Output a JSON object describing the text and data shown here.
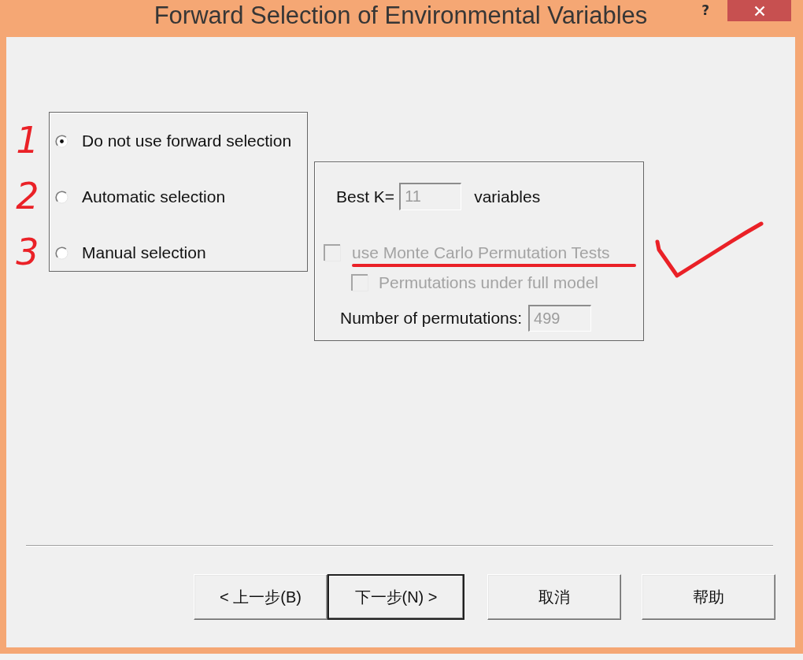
{
  "window": {
    "title": "Forward Selection of Environmental Variables",
    "help": "?"
  },
  "selection_mode": {
    "options": [
      {
        "label": "Do not use forward selection",
        "selected": true,
        "annotation": "1"
      },
      {
        "label": "Automatic selection",
        "selected": false,
        "annotation": "2"
      },
      {
        "label": "Manual selection",
        "selected": false,
        "annotation": "3"
      }
    ]
  },
  "settings": {
    "best_k": {
      "label": "Best K=",
      "value": "11",
      "unit": "variables",
      "disabled": true
    },
    "checkboxes": [
      {
        "label": "use Monte Carlo Permutation Tests",
        "checked": false,
        "disabled": true,
        "underlined": true
      },
      {
        "label": "Permutations under full model",
        "checked": false,
        "disabled": true,
        "underlined": false
      }
    ],
    "permutations": {
      "label": "Number of permutations:",
      "value": "499",
      "disabled": true
    }
  },
  "annotations": {
    "checkmark": true
  },
  "buttons": [
    {
      "label": "< 上一步(B)",
      "default": false
    },
    {
      "label": "下一步(N) >",
      "default": true
    },
    {
      "label": "取消",
      "default": false
    },
    {
      "label": "帮助",
      "default": false
    }
  ]
}
